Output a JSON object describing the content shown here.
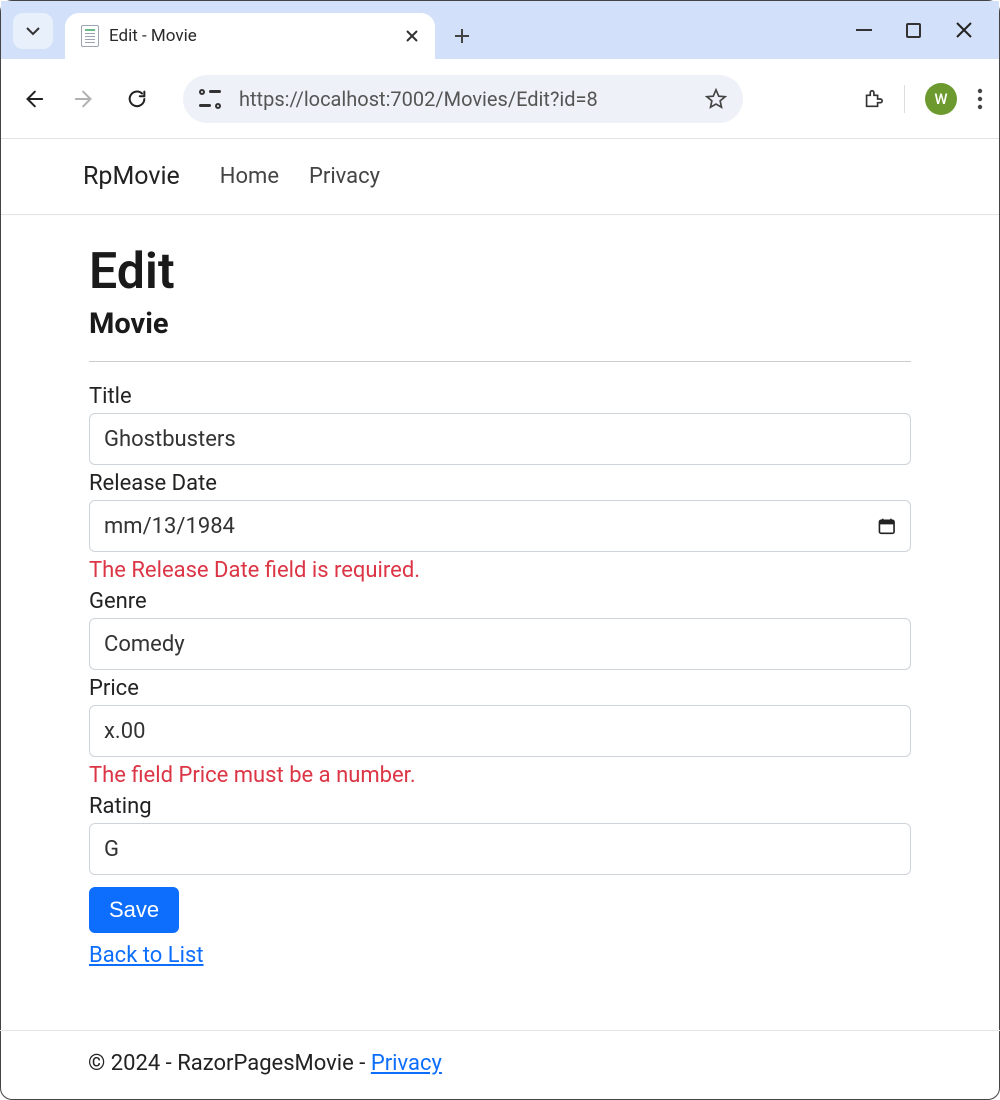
{
  "window": {
    "tab_title": "Edit - Movie",
    "url": "https://localhost:7002/Movies/Edit?id=8",
    "avatar_letter": "W"
  },
  "nav": {
    "brand": "RpMovie",
    "home": "Home",
    "privacy": "Privacy"
  },
  "page": {
    "heading": "Edit",
    "sub": "Movie"
  },
  "form": {
    "title_label": "Title",
    "title_value": "Ghostbusters",
    "releasedate_label": "Release Date",
    "releasedate_value": "mm/13/1984",
    "releasedate_error": "The Release Date field is required.",
    "genre_label": "Genre",
    "genre_value": "Comedy",
    "price_label": "Price",
    "price_value": "x.00",
    "price_error": "The field Price must be a number.",
    "rating_label": "Rating",
    "rating_value": "G",
    "save_button": "Save",
    "back_link": "Back to List"
  },
  "footer": {
    "text_prefix": "© 2024 - RazorPagesMovie - ",
    "privacy": "Privacy"
  }
}
